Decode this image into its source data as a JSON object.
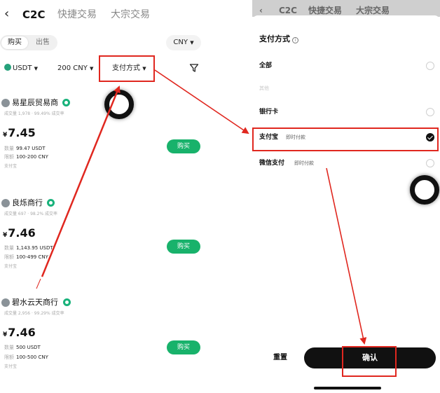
{
  "left": {
    "nav": {
      "tabs": [
        "C2C",
        "快捷交易",
        "大宗交易"
      ],
      "active_tab": "C2C"
    },
    "trade_toggle": {
      "buy": "购买",
      "sell": "出售"
    },
    "currency": "CNY",
    "filters": {
      "coin": "USDT",
      "amount": "200 CNY",
      "payment": "支付方式"
    },
    "merchants": [
      {
        "name": "易星辰贸易商",
        "stats": "成交量 1,978 · 99.49% 成交率",
        "currency_symbol": "¥",
        "price": "7.45",
        "qty_label": "数量",
        "qty": "99.47 USDT",
        "limit_label": "限额",
        "limit": "100-200 CNY",
        "payment": "支付宝",
        "buy_label": "购买"
      },
      {
        "name": "良烁商行",
        "stats": "成交量 697 · 98.2% 成交率",
        "currency_symbol": "¥",
        "price": "7.46",
        "qty_label": "数量",
        "qty": "1,143.95 USDT",
        "limit_label": "限额",
        "limit": "100-499 CNY",
        "payment": "支付宝",
        "buy_label": "购买"
      },
      {
        "name": "碧水云天商行",
        "stats": "成交量 2,956 · 99.29% 成交率",
        "currency_symbol": "¥",
        "price": "7.46",
        "qty_label": "数量",
        "qty": "500 USDT",
        "limit_label": "限额",
        "limit": "100-500 CNY",
        "payment": "支付宝",
        "buy_label": "购买"
      }
    ]
  },
  "right": {
    "dim_header": {
      "tabs": [
        "C2C",
        "快捷交易",
        "大宗交易"
      ]
    },
    "sheet": {
      "title": "支付方式",
      "options": [
        {
          "label": "全部",
          "sub": "",
          "checked": false
        },
        {
          "label": "其他",
          "sub": "",
          "checked": false,
          "faint": true
        },
        {
          "label": "银行卡",
          "sub": "",
          "checked": false
        },
        {
          "label": "支付宝",
          "sub": "即时付款",
          "checked": true
        },
        {
          "label": "微信支付",
          "sub": "即时付款",
          "checked": false
        }
      ],
      "reset_label": "重置",
      "confirm_label": "确认"
    }
  },
  "colors": {
    "highlight_red": "#e0271f",
    "buy_green": "#18b26b",
    "verified_green": "#19b27b",
    "tether_green": "#26a17b"
  }
}
